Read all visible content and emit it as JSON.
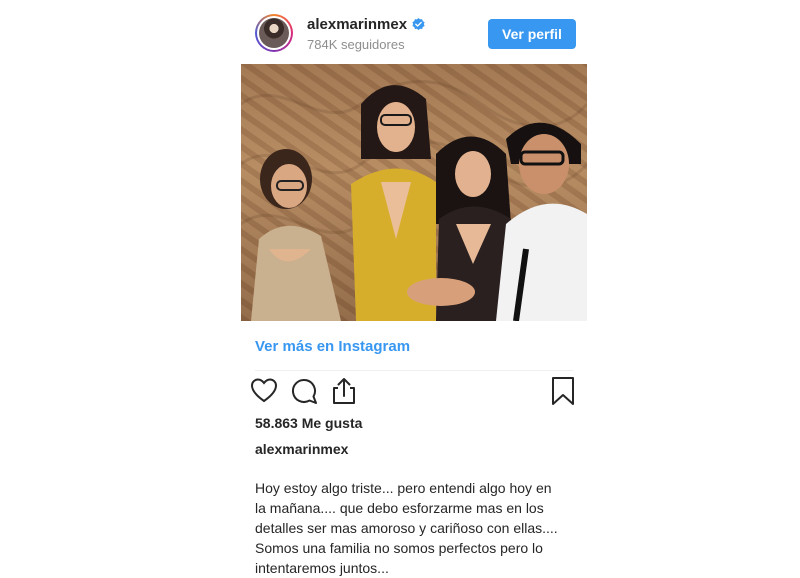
{
  "header": {
    "username": "alexmarinmex",
    "followers": "784K seguidores",
    "view_profile_label": "Ver perfil"
  },
  "icons": {
    "avatar": "profile-avatar",
    "verified": "verified-badge-icon",
    "like": "heart-icon",
    "comment": "comment-icon",
    "share": "share-icon",
    "save": "bookmark-icon"
  },
  "more_link": "Ver más en Instagram",
  "likes": "58.863 Me gusta",
  "caption": {
    "username": "alexmarinmex",
    "text_lines": [
      "Hoy estoy algo triste... pero entendi algo hoy en",
      "la mañana.... que debo esforzarme mas en los",
      "detalles ser mas amoroso y cariñoso con ellas....",
      "Somos una familia no somos perfectos pero lo",
      "intentaremos juntos..."
    ]
  },
  "colors": {
    "accent": "#3897f0",
    "text": "#262626",
    "muted": "#8e8e8e"
  }
}
